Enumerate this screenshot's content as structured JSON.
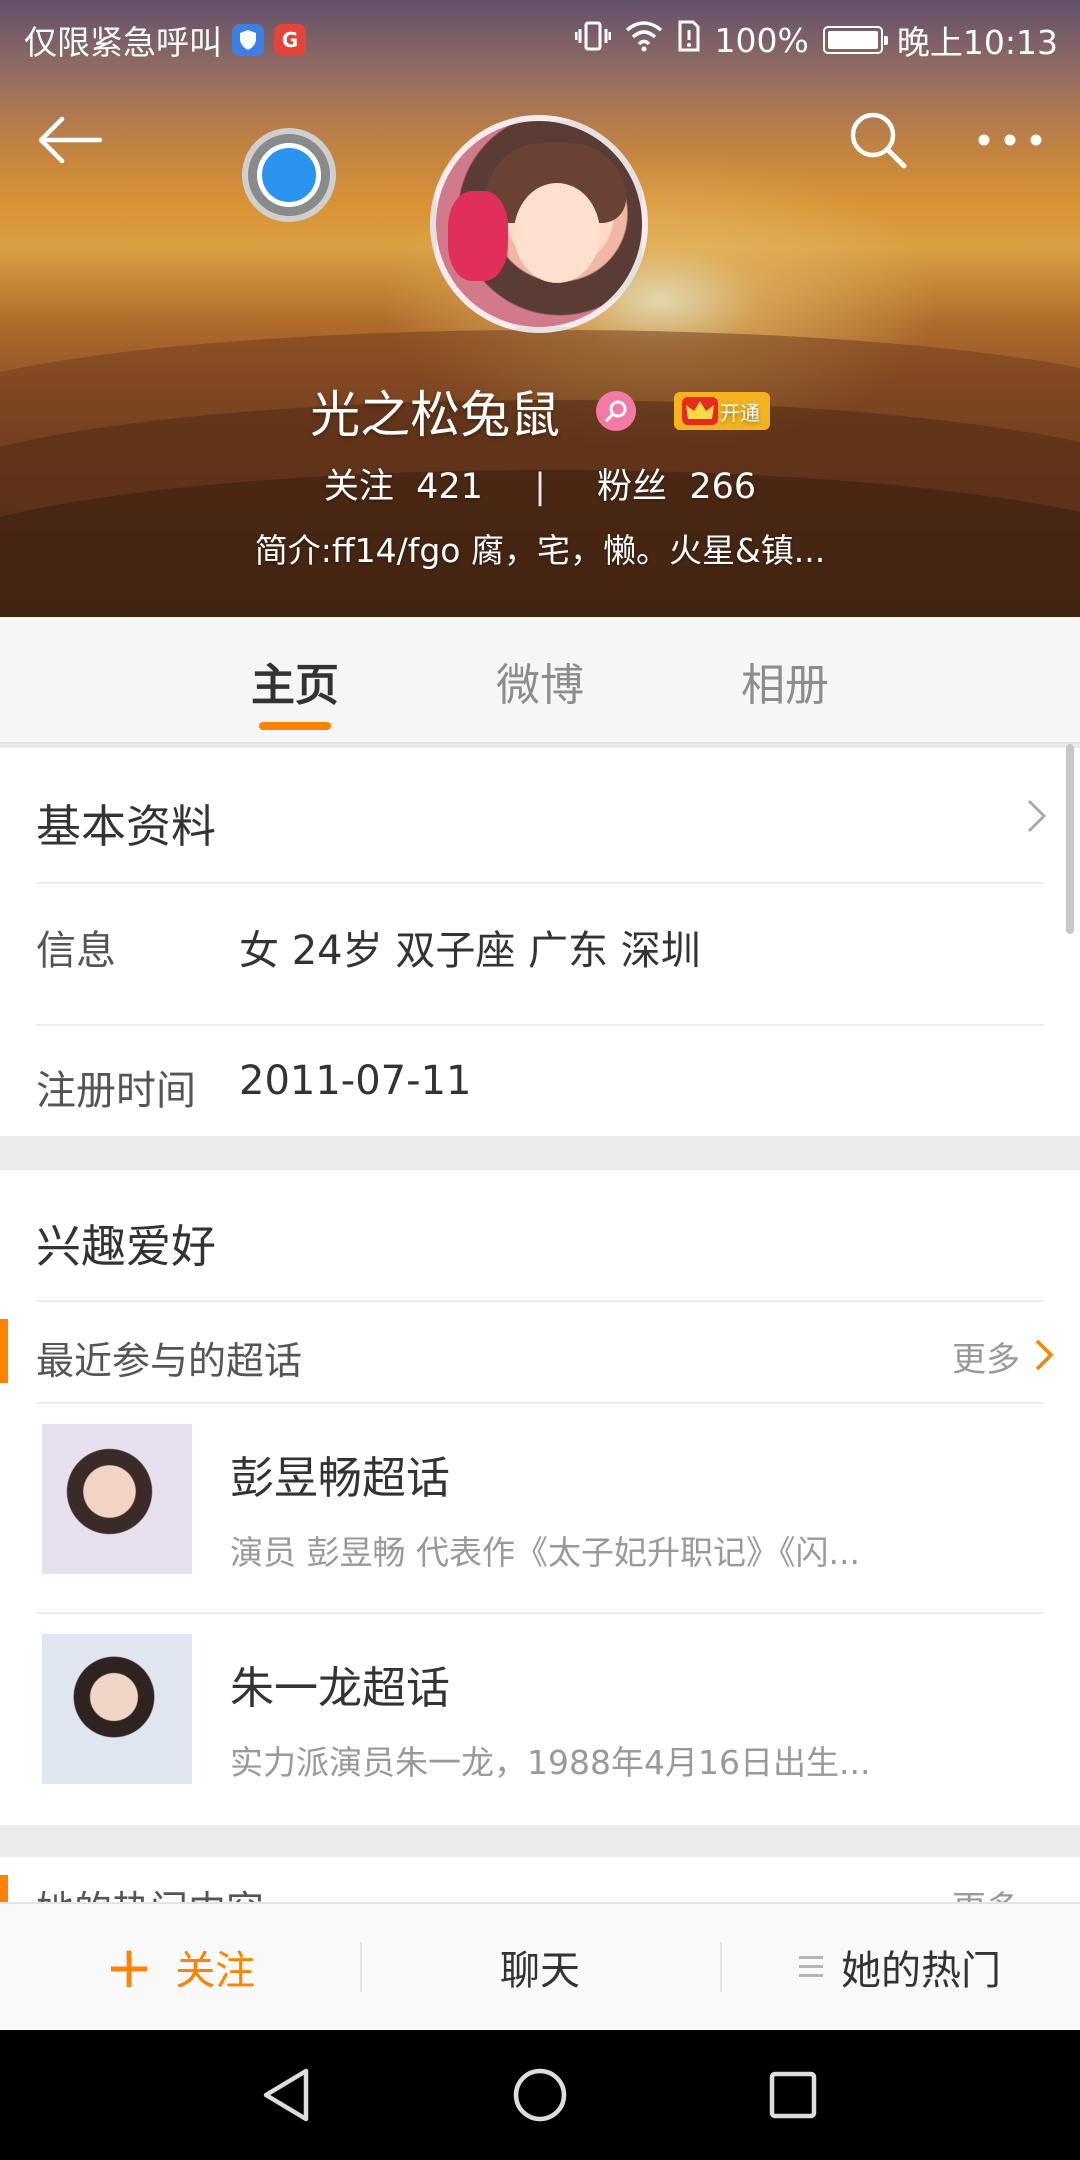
{
  "status_bar": {
    "carrier": "仅限紧急呼叫",
    "battery": "100%",
    "time": "晚上10:13"
  },
  "profile": {
    "name": "光之松兔鼠",
    "vip_label": "开通",
    "following_label": "关注",
    "following_count": "421",
    "followers_label": "粉丝",
    "followers_count": "266",
    "separator": "|",
    "bio": "简介:ff14/fgo 腐，宅，懒。火星&镇..."
  },
  "tabs": [
    {
      "label": "主页",
      "active": true
    },
    {
      "label": "微博",
      "active": false
    },
    {
      "label": "相册",
      "active": false
    }
  ],
  "basic_info": {
    "title": "基本资料",
    "info_label": "信息",
    "info_value": "女  24岁  双子座  广东 深圳",
    "register_label": "注册时间",
    "register_value": "2011-07-11"
  },
  "hobbies": {
    "title": "兴趣爱好",
    "section_label": "最近参与的超话",
    "more_label": "更多",
    "topics": [
      {
        "name": "彭昱畅超话",
        "desc": "演员 彭昱畅 代表作《太子妃升职记》《闪..."
      },
      {
        "name": "朱一龙超话",
        "desc": "实力派演员朱一龙，1988年4月16日出生..."
      }
    ]
  },
  "hot_section": {
    "label": "她的热门内容",
    "more_label": "更多"
  },
  "actions": {
    "follow": "关注",
    "chat": "聊天",
    "hot": "她的热门"
  },
  "colors": {
    "accent": "#ff8200",
    "text_primary": "#333333",
    "text_secondary": "#999999"
  }
}
